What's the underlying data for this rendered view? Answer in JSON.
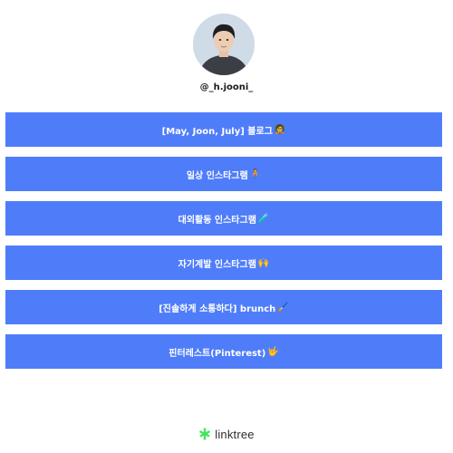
{
  "profile": {
    "username": "@_h.jooni_"
  },
  "links": [
    {
      "label": "[May, Joon, July] 블로그",
      "icon": "🧑‍🏫",
      "icon_name": "teacher-emoji-icon"
    },
    {
      "label": "일상 인스타그램",
      "icon": "🧍",
      "icon_name": "person-emoji-icon"
    },
    {
      "label": "대외활동 인스타그램",
      "icon": "🧪",
      "icon_name": "test-tube-emoji-icon"
    },
    {
      "label": "자기계발 인스타그램",
      "icon": "🙌",
      "icon_name": "raised-hands-emoji-icon"
    },
    {
      "label": "[진솔하게 소통하다] brunch",
      "icon": "🖌️",
      "icon_name": "paintbrush-emoji-icon"
    },
    {
      "label": "핀터레스트(Pinterest)",
      "icon": "🤟",
      "icon_name": "hand-emoji-icon"
    }
  ],
  "footer": {
    "brand": "linktree"
  },
  "colors": {
    "button_bg": "#4f7dfa",
    "button_text": "#ffffff",
    "logo_green": "#43e55e"
  }
}
